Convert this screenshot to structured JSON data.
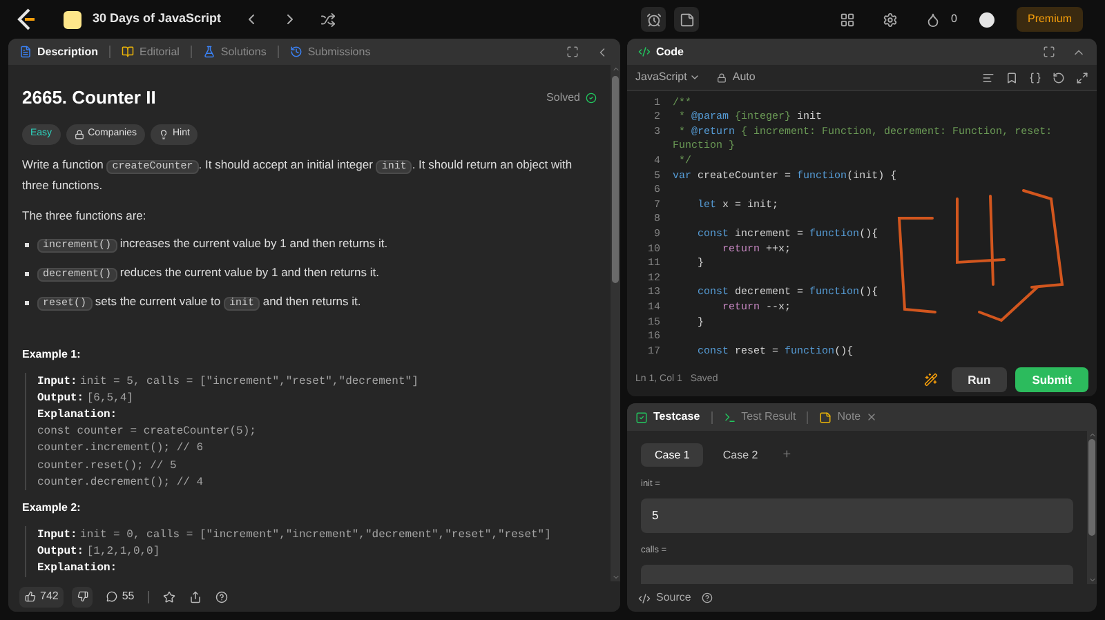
{
  "topbar": {
    "title": "30 Days of JavaScript",
    "streak": "0",
    "premium": "Premium"
  },
  "left_tabs": [
    {
      "label": "Description",
      "selected": true
    },
    {
      "label": "Editorial",
      "selected": false
    },
    {
      "label": "Solutions",
      "selected": false
    },
    {
      "label": "Submissions",
      "selected": false
    }
  ],
  "problem": {
    "title": "2665. Counter II",
    "status": "Solved",
    "tags": [
      {
        "label": "Easy",
        "kind": "difficulty"
      },
      {
        "label": "Companies",
        "kind": "lock"
      },
      {
        "label": "Hint",
        "kind": "bulb"
      }
    ],
    "paragraphs": [
      [
        {
          "kind": "text",
          "t": "Write a function "
        },
        {
          "kind": "code",
          "t": "createCounter"
        },
        {
          "kind": "text",
          "t": ". It should accept an initial integer "
        },
        {
          "kind": "code",
          "t": "init"
        },
        {
          "kind": "text",
          "t": ". It should return an object with three functions."
        }
      ],
      [
        {
          "kind": "text",
          "t": "The three functions are:"
        }
      ]
    ],
    "bullets": [
      [
        {
          "kind": "code",
          "t": "increment()"
        },
        {
          "kind": "text",
          "t": " increases the current value by 1 and then returns it."
        }
      ],
      [
        {
          "kind": "code",
          "t": "decrement()"
        },
        {
          "kind": "text",
          "t": " reduces the current value by 1 and then returns it."
        }
      ],
      [
        {
          "kind": "code",
          "t": "reset()"
        },
        {
          "kind": "text",
          "t": " sets the current value to "
        },
        {
          "kind": "code",
          "t": "init"
        },
        {
          "kind": "text",
          "t": " and then returns it."
        }
      ]
    ],
    "examples": [
      {
        "title": "Example 1:",
        "lines": [
          {
            "label": "Input:",
            "t": "init = 5, calls = [\"increment\",\"reset\",\"decrement\"]"
          },
          {
            "label": "Output:",
            "t": "[6,5,4]"
          },
          {
            "label": "Explanation:"
          },
          {
            "t": "const counter = createCounter(5);"
          },
          {
            "t": "counter.increment(); // 6"
          },
          {
            "t": "counter.reset(); // 5"
          },
          {
            "t": "counter.decrement(); // 4"
          }
        ]
      },
      {
        "title": "Example 2:",
        "lines": [
          {
            "label": "Input:",
            "t": "init = 0, calls = [\"increment\",\"increment\",\"decrement\",\"reset\",\"reset\"]"
          },
          {
            "label": "Output:",
            "t": "[1,2,1,0,0]"
          },
          {
            "label": "Explanation:"
          }
        ]
      }
    ]
  },
  "footer": {
    "likes": "742",
    "comments": "55"
  },
  "code": {
    "title": "Code",
    "language": "JavaScript",
    "mode": "Auto",
    "lines": [
      {
        "num": "1",
        "tokens": [
          {
            "kind": "cm",
            "t": "/**"
          }
        ]
      },
      {
        "num": "2",
        "tokens": [
          {
            "kind": "cm",
            "t": " * "
          },
          {
            "kind": "tag",
            "t": "@param"
          },
          {
            "kind": "cm",
            "t": " {integer} "
          },
          {
            "kind": "id",
            "t": "init"
          }
        ]
      },
      {
        "num": "3",
        "tokens": [
          {
            "kind": "cm",
            "t": " * "
          },
          {
            "kind": "tag",
            "t": "@return"
          },
          {
            "kind": "cm",
            "t": " { increment: Function, decrement: Function, reset:"
          }
        ]
      },
      {
        "tokens": [
          {
            "kind": "cm",
            "t": "Function }"
          }
        ]
      },
      {
        "num": "4",
        "tokens": [
          {
            "kind": "cm",
            "t": " */"
          }
        ]
      },
      {
        "num": "5",
        "tokens": [
          {
            "kind": "kw",
            "t": "var"
          },
          {
            "kind": "id",
            "t": " createCounter "
          },
          {
            "kind": "op",
            "t": "= "
          },
          {
            "kind": "kw",
            "t": "function"
          },
          {
            "kind": "id",
            "t": "(init) {"
          }
        ]
      },
      {
        "num": "6"
      },
      {
        "num": "7",
        "tokens": [
          {
            "kind": "kw",
            "t": "    let"
          },
          {
            "kind": "id",
            "t": " x "
          },
          {
            "kind": "op",
            "t": "= "
          },
          {
            "kind": "id",
            "t": "init;"
          }
        ]
      },
      {
        "num": "8"
      },
      {
        "num": "9",
        "tokens": [
          {
            "kind": "kw",
            "t": "    const"
          },
          {
            "kind": "id",
            "t": " increment "
          },
          {
            "kind": "op",
            "t": "= "
          },
          {
            "kind": "kw",
            "t": "function"
          },
          {
            "kind": "id",
            "t": "(){"
          }
        ]
      },
      {
        "num": "10",
        "tokens": [
          {
            "kind": "ctl",
            "t": "        return"
          },
          {
            "kind": "id",
            "t": " ++x;"
          }
        ]
      },
      {
        "num": "11",
        "tokens": [
          {
            "kind": "id",
            "t": "    }"
          }
        ]
      },
      {
        "num": "12"
      },
      {
        "num": "13",
        "tokens": [
          {
            "kind": "kw",
            "t": "    const"
          },
          {
            "kind": "id",
            "t": " decrement "
          },
          {
            "kind": "op",
            "t": "= "
          },
          {
            "kind": "kw",
            "t": "function"
          },
          {
            "kind": "id",
            "t": "(){"
          }
        ]
      },
      {
        "num": "14",
        "tokens": [
          {
            "kind": "ctl",
            "t": "        return"
          },
          {
            "kind": "id",
            "t": " --x;"
          }
        ]
      },
      {
        "num": "15",
        "tokens": [
          {
            "kind": "id",
            "t": "    }"
          }
        ]
      },
      {
        "num": "16"
      },
      {
        "num": "17",
        "tokens": [
          {
            "kind": "kw",
            "t": "    const"
          },
          {
            "kind": "id",
            "t": " reset "
          },
          {
            "kind": "op",
            "t": "= "
          },
          {
            "kind": "kw",
            "t": "function"
          },
          {
            "kind": "id",
            "t": "(){"
          }
        ]
      }
    ],
    "cursor": "Ln 1, Col 1",
    "save_state": "Saved",
    "run": "Run",
    "submit": "Submit"
  },
  "bottom_tabs": [
    {
      "label": "Testcase",
      "selected": true
    },
    {
      "label": "Test Result",
      "selected": false
    },
    {
      "label": "Note",
      "selected": false
    }
  ],
  "cases": [
    {
      "label": "Case 1",
      "selected": true
    },
    {
      "label": "Case 2",
      "selected": false
    }
  ],
  "add_case": "+",
  "inputs": [
    {
      "label": "init =",
      "value": "5"
    },
    {
      "label": "calls ="
    }
  ],
  "source": "Source"
}
